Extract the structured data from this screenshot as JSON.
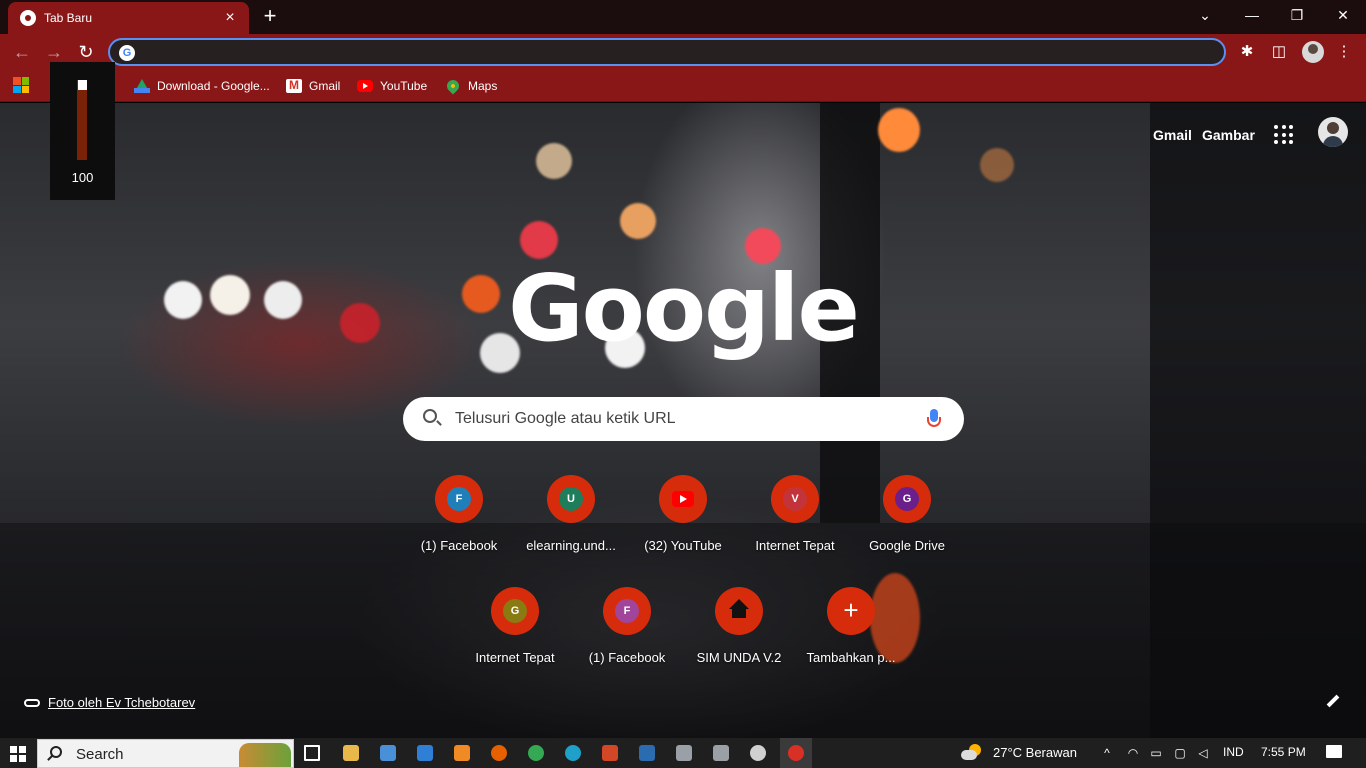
{
  "tab": {
    "title": "Tab Baru",
    "close": "×",
    "new_tab": "+"
  },
  "window_controls": {
    "minimize": "—",
    "maximize": "❐",
    "close": "✕",
    "tab_search": "⌄"
  },
  "toolbar": {
    "back": "←",
    "forward": "→",
    "reload": "↻",
    "omnibox_value": "",
    "omnibox_g": "G",
    "extensions": "✱",
    "side_panel": "◫",
    "menu": "⋮"
  },
  "bookmarks": [
    {
      "label": "Download - Google...",
      "icon": "google-drive-icon"
    },
    {
      "label": "Gmail",
      "icon": "gmail-icon"
    },
    {
      "label": "YouTube",
      "icon": "youtube-icon"
    },
    {
      "label": "Maps",
      "icon": "maps-icon"
    }
  ],
  "volume": {
    "value": "100",
    "level": 1.0
  },
  "ntp": {
    "gmail": "Gmail",
    "images": "Gambar",
    "logo": "Google",
    "search_placeholder": "Telusuri Google atau ketik URL",
    "credit": "Foto oleh Ev Tchebotarev",
    "shortcuts": [
      {
        "label": "(1) Facebook",
        "letter": "F",
        "color": "#1f7fb8",
        "type": "letter"
      },
      {
        "label": "elearning.und...",
        "letter": "U",
        "color": "#1e7d5a",
        "type": "letter"
      },
      {
        "label": "(32) YouTube",
        "letter": "",
        "color": "#ff0000",
        "type": "youtube"
      },
      {
        "label": "Internet Tepat",
        "letter": "V",
        "color": "#c2343a",
        "type": "letter"
      },
      {
        "label": "Google Drive",
        "letter": "G",
        "color": "#6a1f8a",
        "type": "letter"
      },
      {
        "label": "Internet Tepat",
        "letter": "G",
        "color": "#8a7a12",
        "type": "letter"
      },
      {
        "label": "(1) Facebook",
        "letter": "F",
        "color": "#a0459a",
        "type": "letter"
      },
      {
        "label": "SIM UNDA V.2",
        "letter": "",
        "color": "#111111",
        "type": "home"
      },
      {
        "label": "Tambahkan p...",
        "letter": "+",
        "color": "#d72c0c",
        "type": "add"
      }
    ]
  },
  "taskbar": {
    "search": "Search",
    "weather": "27°C  Berawan",
    "lang": "IND",
    "time": "7:55 PM"
  }
}
